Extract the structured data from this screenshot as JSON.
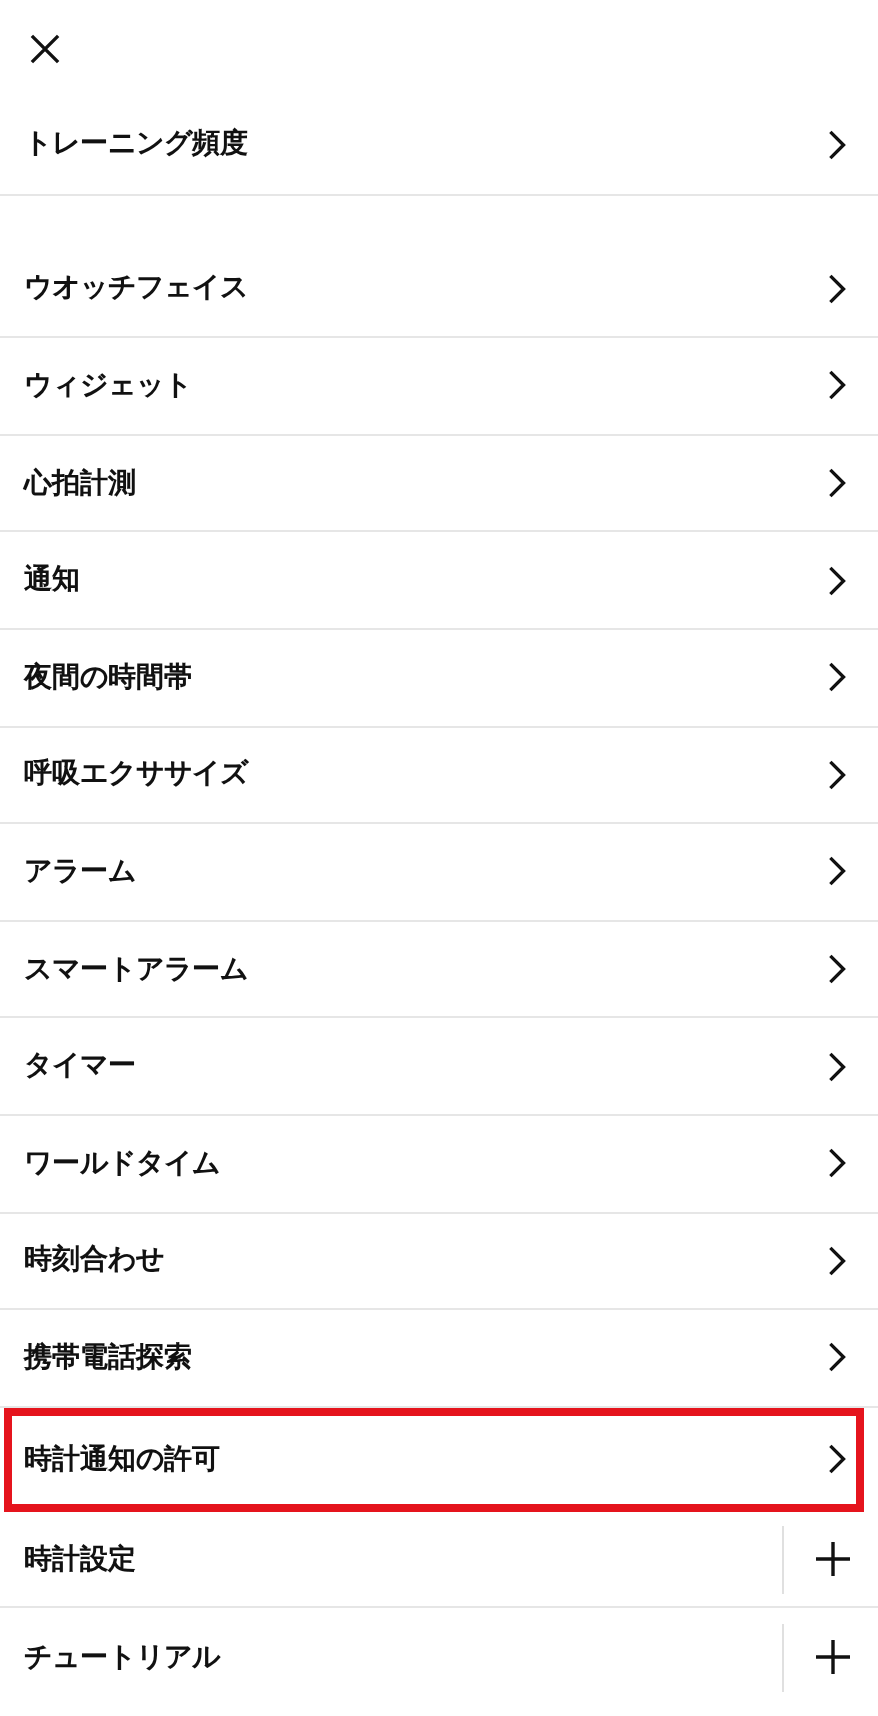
{
  "sections": [
    {
      "items": [
        {
          "label": "トレーニング頻度",
          "kind": "link",
          "highlighted": false
        }
      ]
    },
    {
      "items": [
        {
          "label": "ウオッチフェイス",
          "kind": "link",
          "highlighted": false
        },
        {
          "label": "ウィジェット",
          "kind": "link",
          "highlighted": false
        },
        {
          "label": "心拍計測",
          "kind": "link",
          "highlighted": false
        },
        {
          "label": "通知",
          "kind": "link",
          "highlighted": false
        },
        {
          "label": "夜間の時間帯",
          "kind": "link",
          "highlighted": false
        },
        {
          "label": "呼吸エクササイズ",
          "kind": "link",
          "highlighted": false
        },
        {
          "label": "アラーム",
          "kind": "link",
          "highlighted": false
        },
        {
          "label": "スマートアラーム",
          "kind": "link",
          "highlighted": false
        },
        {
          "label": "タイマー",
          "kind": "link",
          "highlighted": false
        },
        {
          "label": "ワールドタイム",
          "kind": "link",
          "highlighted": false
        },
        {
          "label": "時刻合わせ",
          "kind": "link",
          "highlighted": false
        },
        {
          "label": "携帯電話探索",
          "kind": "link",
          "highlighted": false
        },
        {
          "label": "時計通知の許可",
          "kind": "link",
          "highlighted": true
        },
        {
          "label": "時計設定",
          "kind": "expand",
          "highlighted": false
        },
        {
          "label": "チュートリアル",
          "kind": "expand",
          "highlighted": false
        }
      ]
    }
  ]
}
